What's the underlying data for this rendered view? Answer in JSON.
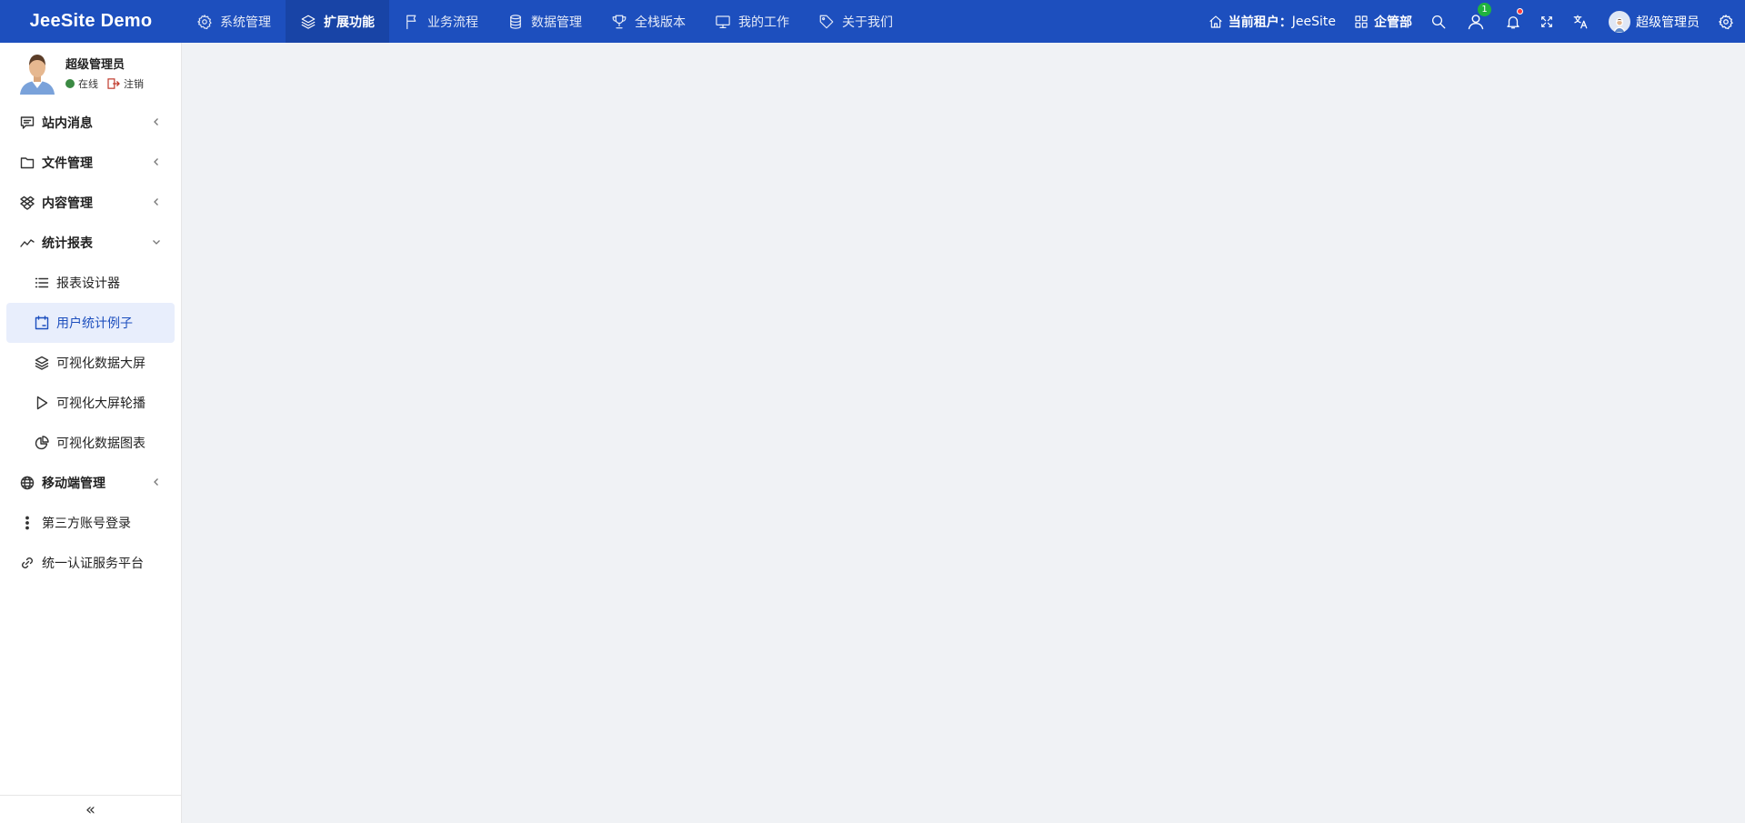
{
  "brand": "JeeSite Demo",
  "topnav": [
    {
      "label": "系统管理",
      "icon": "gear-icon",
      "active": false
    },
    {
      "label": "扩展功能",
      "icon": "layers-icon",
      "active": true
    },
    {
      "label": "业务流程",
      "icon": "flag-icon",
      "active": false
    },
    {
      "label": "数据管理",
      "icon": "database-icon",
      "active": false
    },
    {
      "label": "全栈版本",
      "icon": "trophy-icon",
      "active": false
    },
    {
      "label": "我的工作",
      "icon": "monitor-icon",
      "active": false
    },
    {
      "label": "关于我们",
      "icon": "tag-icon",
      "active": false
    }
  ],
  "right": {
    "tenant_label": "当前租户：",
    "tenant_value": "JeeSite",
    "org": "企管部",
    "online_users_badge": "1",
    "username": "超级管理员"
  },
  "sidebar": {
    "user": {
      "name": "超级管理员",
      "status": "在线",
      "logout": "注销"
    },
    "items": [
      {
        "label": "站内消息",
        "icon": "message-icon"
      },
      {
        "label": "文件管理",
        "icon": "folder-icon"
      },
      {
        "label": "内容管理",
        "icon": "dropbox-icon"
      },
      {
        "label": "统计报表",
        "icon": "line-chart-icon",
        "expanded": true,
        "children": [
          {
            "label": "报表设计器",
            "icon": "list-icon"
          },
          {
            "label": "用户统计例子",
            "icon": "calendar-icon",
            "active": true
          },
          {
            "label": "可视化数据大屏",
            "icon": "layers-icon"
          },
          {
            "label": "可视化大屏轮播",
            "icon": "play-icon"
          },
          {
            "label": "可视化数据图表",
            "icon": "pie-icon"
          }
        ]
      },
      {
        "label": "移动端管理",
        "icon": "globe-icon"
      },
      {
        "label": "第三方账号登录",
        "icon": "more-vertical-icon"
      },
      {
        "label": "统一认证服务平台",
        "icon": "link-icon"
      }
    ]
  },
  "colors": {
    "topbar": "#1d4fbe",
    "active_nav": "#1844a6",
    "active_item_bg": "#e8eefc",
    "content_bg": "#f0f2f5"
  }
}
